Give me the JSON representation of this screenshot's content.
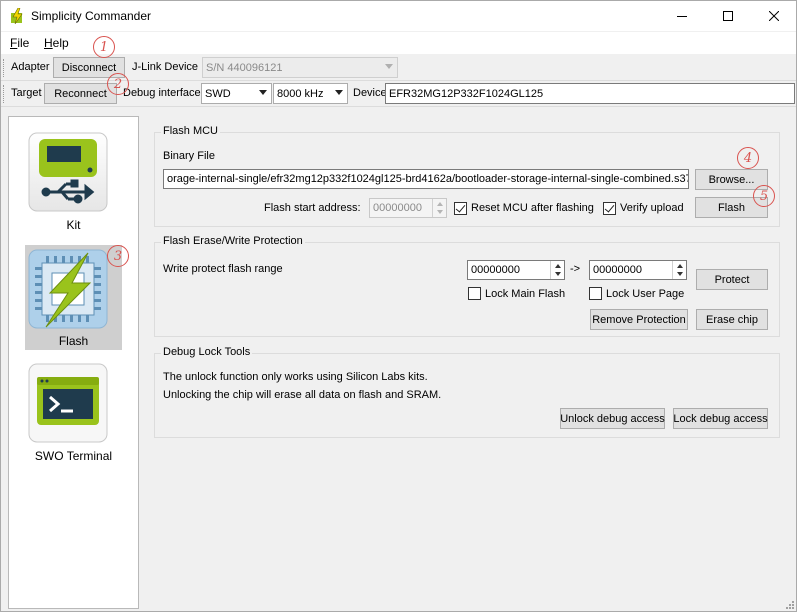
{
  "window": {
    "title": "Simplicity Commander"
  },
  "menu": {
    "file": {
      "accel": "F",
      "rest": "ile"
    },
    "help": {
      "accel": "H",
      "rest": "elp"
    }
  },
  "adapter_bar": {
    "adapter_label": "Adapter",
    "disconnect_label": "Disconnect",
    "jlink_label": "J-Link Device",
    "jlink_value": "S/N 440096121"
  },
  "target_bar": {
    "target_label": "Target",
    "reconnect_label": "Reconnect",
    "debug_interface_label": "Debug interface",
    "debug_interface_value": "SWD",
    "speed_value": "8000 kHz",
    "device_label": "Device",
    "device_value": "EFR32MG12P332F1024GL125"
  },
  "nav": {
    "kit_label": "Kit",
    "flash_label": "Flash",
    "swo_label": "SWO Terminal",
    "selected": "Flash"
  },
  "flash_mcu": {
    "title": "Flash MCU",
    "binary_file_label": "Binary File",
    "binary_file_value": "orage-internal-single/efr32mg12p332f1024gl125-brd4162a/bootloader-storage-internal-single-combined.s37",
    "browse_label": "Browse...",
    "start_address_label": "Flash start address:",
    "start_address_value": "00000000",
    "reset_mcu_label": "Reset MCU after flashing",
    "reset_mcu_checked": true,
    "verify_label": "Verify upload",
    "verify_checked": true,
    "flash_label": "Flash"
  },
  "protection": {
    "title": "Flash Erase/Write Protection",
    "range_label": "Write protect flash range",
    "range_from": "00000000",
    "arrow": "->",
    "range_to": "00000000",
    "protect_label": "Protect",
    "lock_main_label": "Lock Main Flash",
    "lock_user_label": "Lock User Page",
    "remove_protection_label": "Remove Protection",
    "erase_chip_label": "Erase chip"
  },
  "debug_lock": {
    "title": "Debug Lock Tools",
    "line1": "The unlock function only works using Silicon Labs kits.",
    "line2": "Unlocking the chip will erase all data on flash and SRAM.",
    "unlock_label": "Unlock debug access",
    "lock_label": "Lock debug access"
  },
  "annotations": [
    "1",
    "2",
    "3",
    "4",
    "5"
  ],
  "colors": {
    "accent_green": "#9ac31c",
    "tile_blue": "#aed0ea",
    "annotation_red": "#d9534f"
  }
}
